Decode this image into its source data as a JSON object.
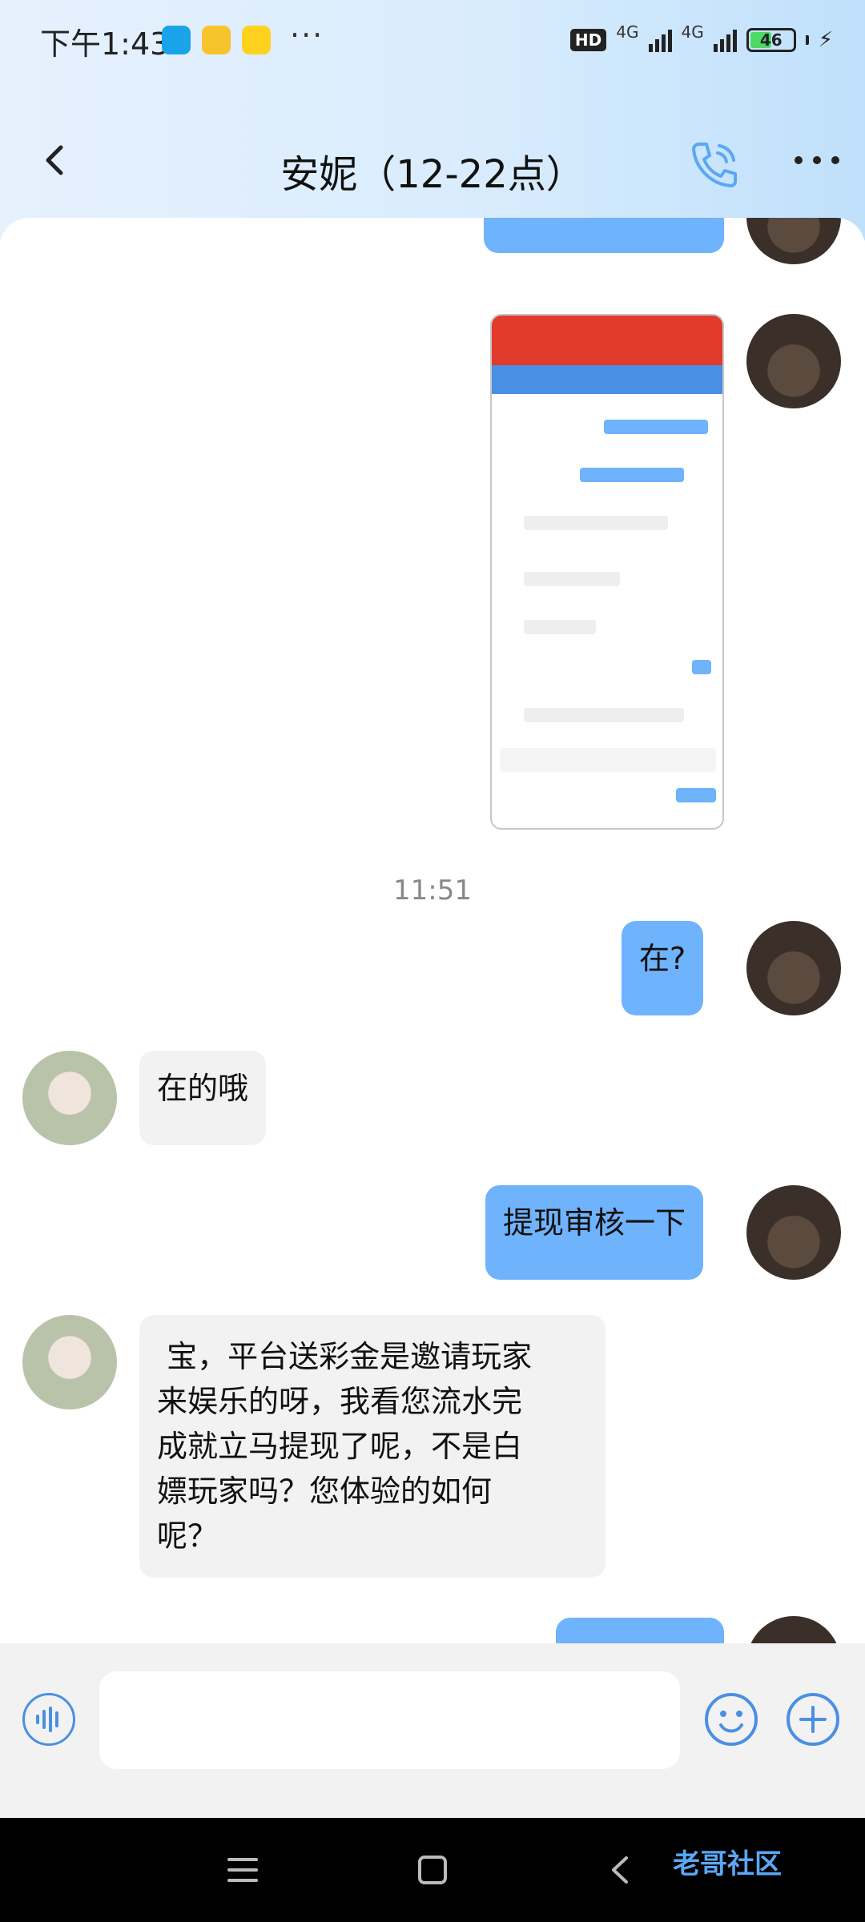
{
  "status_bar": {
    "time": "下午1:43",
    "dots": "···",
    "hd": "HD",
    "net1": "4G",
    "net2": "4G",
    "battery": "46"
  },
  "header": {
    "title": "安妮（12-22点）",
    "back_icon": "chevron-left-icon",
    "call_icon": "phone-icon",
    "more_icon": "more-icon"
  },
  "messages": [
    {
      "from": "me",
      "type": "image"
    },
    {
      "type": "time",
      "text": "11:51"
    },
    {
      "from": "me",
      "text": "在?"
    },
    {
      "from": "her",
      "text": "在的哦"
    },
    {
      "from": "me",
      "text": "提现审核一下"
    },
    {
      "from": "her",
      "lines": [
        " 宝，平台送彩金是邀请玩家",
        "来娱乐的呀，我看您流水完",
        "成就立马提现了呢，不是白",
        "嫖玩家吗？您体验的如何",
        "呢？"
      ]
    }
  ],
  "input_bar": {
    "placeholder": ""
  },
  "watermark": "老哥社区",
  "colors": {
    "bubble_me": "#6fb3fc",
    "bubble_her": "#f2f2f2",
    "accent": "#4a90e2"
  }
}
